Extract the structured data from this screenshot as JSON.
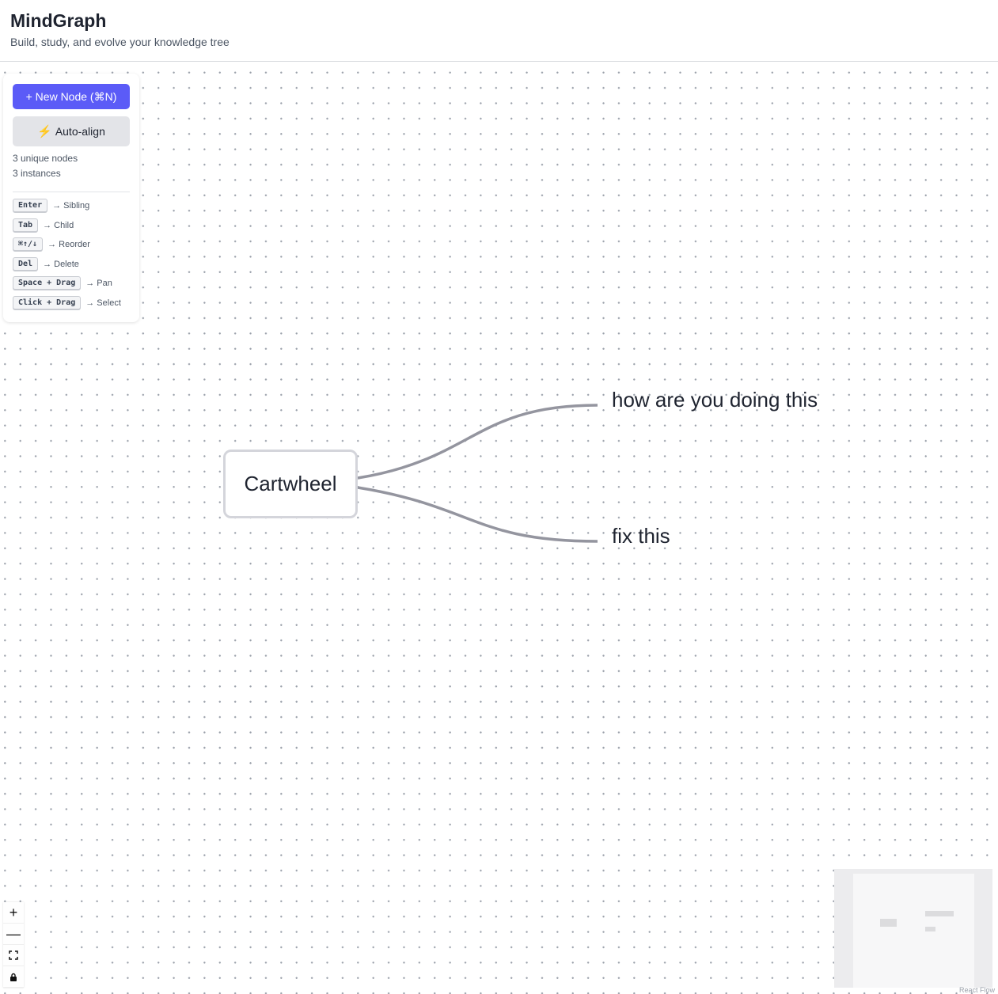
{
  "header": {
    "title": "MindGraph",
    "subtitle": "Build, study, and evolve your knowledge tree"
  },
  "panel": {
    "new_node_label": "+ New Node (⌘N)",
    "auto_align_label": "Auto-align",
    "unique_nodes": "3 unique nodes",
    "instances": "3 instances",
    "shortcuts": [
      {
        "key": "Enter",
        "action": "→ Sibling"
      },
      {
        "key": "Tab",
        "action": "→ Child"
      },
      {
        "key": "⌘↑/↓",
        "action": "→ Reorder"
      },
      {
        "key": "Del",
        "action": "→ Delete"
      },
      {
        "key": "Space + Drag",
        "action": "→ Pan"
      },
      {
        "key": "Click + Drag",
        "action": "→ Select"
      }
    ]
  },
  "graph": {
    "root": "Cartwheel",
    "children": [
      "how are you doing this",
      "fix this"
    ]
  },
  "controls": {
    "zoom_in": "+",
    "zoom_out": "—"
  },
  "attribution": "React Flow",
  "colors": {
    "primary": "#5b5bf7",
    "edge": "#94959f",
    "node_border": "#d4d5db"
  }
}
